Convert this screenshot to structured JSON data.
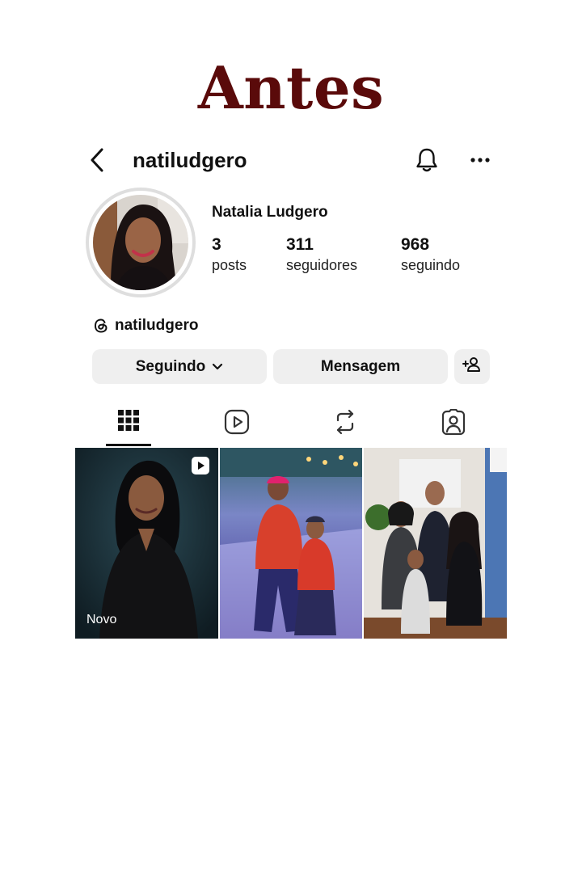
{
  "heading": "Antes",
  "profile": {
    "username": "natiludgero",
    "display_name": "Natalia Ludgero",
    "stats": {
      "posts_value": "3",
      "posts_label": "posts",
      "followers_value": "311",
      "followers_label": "seguidores",
      "following_value": "968",
      "following_label": "seguindo"
    },
    "threads_handle": "natiludgero"
  },
  "buttons": {
    "following": "Seguindo",
    "message": "Mensagem"
  },
  "tabs": [
    "grid-icon",
    "reels-icon",
    "reposts-icon",
    "tagged-icon"
  ],
  "grid": {
    "first_post_label": "Novo"
  },
  "colors": {
    "heading": "#5a0a0a",
    "button_bg": "#efefef"
  }
}
